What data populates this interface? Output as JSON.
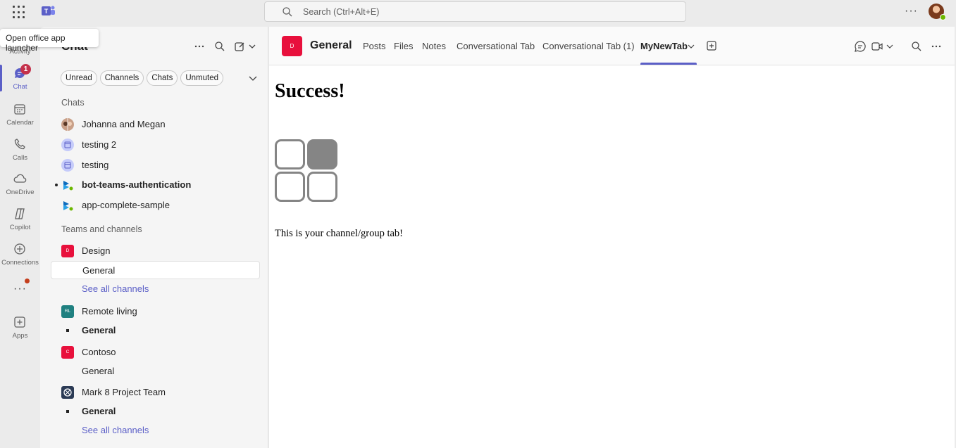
{
  "topbar": {
    "search_placeholder": "Search (Ctrl+Alt+E)",
    "more_label": "···"
  },
  "tooltip": {
    "text": "Open office app launcher"
  },
  "rail": {
    "items": [
      {
        "label": "Activity"
      },
      {
        "label": "Chat",
        "badge": "1"
      },
      {
        "label": "Calendar"
      },
      {
        "label": "Calls"
      },
      {
        "label": "OneDrive"
      },
      {
        "label": "Copilot"
      },
      {
        "label": "Connections"
      },
      {
        "label": "···"
      },
      {
        "label": "Apps"
      }
    ]
  },
  "chat_panel": {
    "title": "Chat",
    "filters": [
      "Unread",
      "Channels",
      "Chats",
      "Unmuted"
    ],
    "chats_section": "Chats",
    "chats": [
      {
        "name": "Johanna and Megan"
      },
      {
        "name": "testing 2"
      },
      {
        "name": "testing"
      },
      {
        "name": "bot-teams-authentication"
      },
      {
        "name": "app-complete-sample"
      }
    ],
    "teams_section": "Teams and channels",
    "teams": [
      {
        "name": "Design",
        "initials": "D",
        "color": "#e8103c"
      },
      {
        "channel": "General"
      },
      {
        "link": "See all channels"
      },
      {
        "name": "Remote living",
        "initials": "RL",
        "color": "#1f8080"
      },
      {
        "channel": "General"
      },
      {
        "name": "Contoso",
        "initials": "C",
        "color": "#e8103c"
      },
      {
        "channel": "General"
      },
      {
        "name": "Mark 8 Project Team"
      },
      {
        "channel": "General"
      },
      {
        "link": "See all channels"
      }
    ]
  },
  "main": {
    "channel_initial": "D",
    "channel_name": "General",
    "tabs": [
      "Posts",
      "Files",
      "Notes",
      "Conversational Tab",
      "Conversational Tab (1)",
      "MyNewTab"
    ],
    "active_tab": "MyNewTab",
    "heading": "Success!",
    "body_text": "This is your channel/group tab!",
    "accent_color": "#5b5fc7"
  }
}
